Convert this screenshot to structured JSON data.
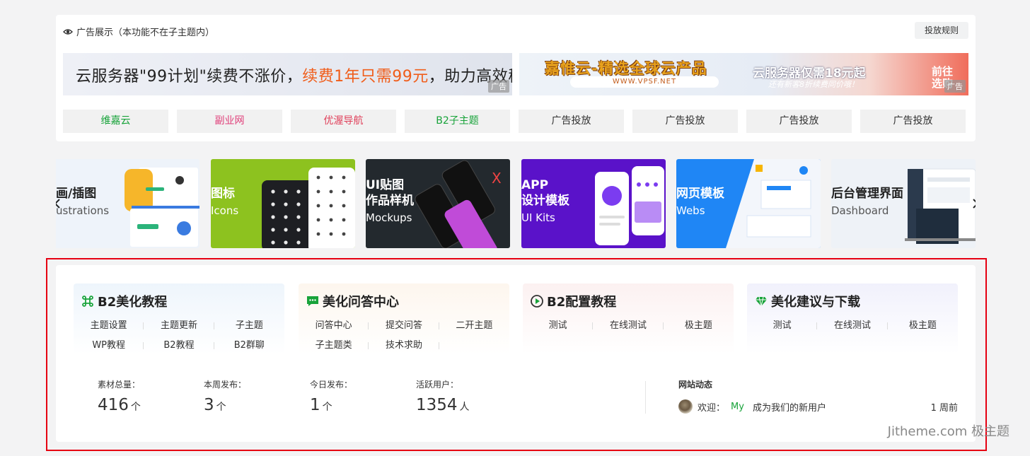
{
  "ad_panel": {
    "title": "广告展示（本功能不在子主题内）",
    "rules_button": "投放规则",
    "banner_left": {
      "text_part1": "云服务器\"99计划\"续费不涨价，",
      "text_highlight": "续费1年只需99元",
      "text_part2": "，助力高效稳定上云",
      "ad_tag": "广告"
    },
    "banner_right": {
      "title": "嘉惟云-精选全球云产品",
      "url": "WWW.VPSF.NET",
      "subtitle": "云服务器仅需18元起",
      "subtitle2": "还有新客8折续费同价哦！",
      "go_line1": "前往",
      "go_line2": "选购"
    },
    "links": [
      {
        "label": "维嘉云",
        "color": "#18a33a"
      },
      {
        "label": "副业网",
        "color": "#e0407a"
      },
      {
        "label": "优渥导航",
        "color": "#e0405a"
      },
      {
        "label": "B2子主题",
        "color": "#18a33a"
      },
      {
        "label": "广告投放",
        "color": "#333333"
      },
      {
        "label": "广告投放",
        "color": "#333333"
      },
      {
        "label": "广告投放",
        "color": "#333333"
      },
      {
        "label": "广告投放",
        "color": "#333333"
      }
    ]
  },
  "carousel": {
    "cards": [
      {
        "title": "画/插图",
        "subtitle": "ustrations",
        "theme": "light"
      },
      {
        "title": "图标",
        "subtitle": "Icons",
        "theme": "green"
      },
      {
        "title": "UI贴图\n作品样机",
        "subtitle": "Mockups",
        "theme": "dark"
      },
      {
        "title": "APP\n设计模板",
        "subtitle": "UI Kits",
        "theme": "purple"
      },
      {
        "title": "网页模板",
        "subtitle": "Webs",
        "theme": "blue"
      },
      {
        "title": "后台管理界面",
        "subtitle": "Dashboard",
        "theme": "light"
      }
    ]
  },
  "categories": [
    {
      "title": "B2美化教程",
      "icon": "command-icon",
      "links": [
        "主题设置",
        "主题更新",
        "子主题",
        "WP教程",
        "B2教程",
        "B2群聊"
      ]
    },
    {
      "title": "美化问答中心",
      "icon": "chat-icon",
      "links": [
        "问答中心",
        "提交问答",
        "二开主题",
        "子主题类",
        "技术求助"
      ]
    },
    {
      "title": "B2配置教程",
      "icon": "play-icon",
      "links": [
        "测试",
        "在线测试",
        "极主题"
      ]
    },
    {
      "title": "美化建议与下载",
      "icon": "gem-icon",
      "links": [
        "测试",
        "在线测试",
        "极主题"
      ]
    }
  ],
  "stats": [
    {
      "label": "素材总量：",
      "value": "416",
      "unit": "个"
    },
    {
      "label": "本周发布：",
      "value": "3",
      "unit": "个"
    },
    {
      "label": "今日发布：",
      "value": "1",
      "unit": "个"
    },
    {
      "label": "活跃用户：",
      "value": "1354",
      "unit": "人"
    }
  ],
  "activity": {
    "title": "网站动态",
    "prefix": "欢迎：",
    "user": "My",
    "action": "成为我们的新用户",
    "time": "1 周前"
  },
  "watermark": "Jitheme.com 极主题",
  "colors": {
    "accent_green": "#18a33a",
    "highlight_orange": "#f05d1a",
    "frame_red": "#e60012"
  }
}
